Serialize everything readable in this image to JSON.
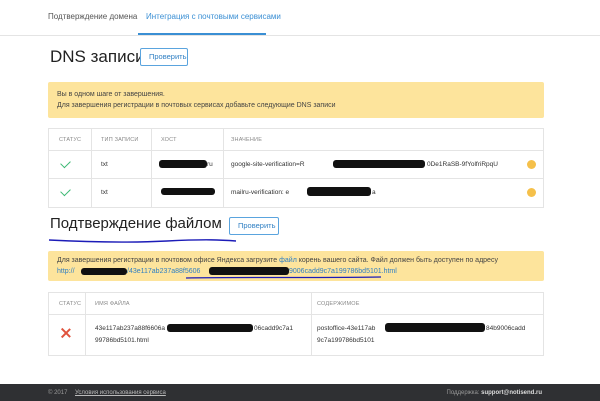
{
  "tabs": [
    {
      "label": "Подтверждение домена"
    },
    {
      "label": "Интеграция с почтовыми сервисами"
    }
  ],
  "dns": {
    "title": "DNS записи",
    "check_button": "Проверить",
    "alert_line1": "Вы в одном шаге от завершения.",
    "alert_line2": "Для завершения регистрации в почтовых сервисах добавьте следующие DNS записи",
    "headers": [
      "СТАТУС",
      "ТИП ЗАПИСИ",
      "ХОСТ",
      "ЗНАЧЕНИЕ"
    ],
    "rows": [
      {
        "status": "ok",
        "type": "txt",
        "host_suffix": "ru",
        "value_start": "google-site-verification=R",
        "value_end": "0De1RaSB-9fYolfriRpqU"
      },
      {
        "status": "ok",
        "type": "txt",
        "host_suffix": "",
        "value_start": "mailru-verification: e",
        "value_end": "a"
      }
    ]
  },
  "file": {
    "title": "Подтверждение файлом",
    "check_button": "Проверить",
    "alert_text_before": "Для завершения регистрации в почтовом офисе Яндекса загрузите",
    "alert_link": "файл",
    "alert_text_after": "корень вашего сайта. Файл должен быть доступен по адресу",
    "url_prefix": "http://",
    "url_mid": "/43e117ab237a88f5606",
    "url_end": "9006cadd9c7a199786bd5101.html",
    "headers": [
      "СТАТУС",
      "ИМЯ ФАЙЛА",
      "СОДЕРЖИМОЕ"
    ],
    "rows": [
      {
        "status": "error",
        "name_start": "43e117ab237a88f6606a",
        "name_end": "06cadd9c7a1",
        "name_line2": "99786bd5101.html",
        "content_start": "postoffice-43e117ab",
        "content_end": "84b9006cadd",
        "content_line2": "9c7a199786bd5101"
      }
    ]
  },
  "footer": {
    "copyright": "© 2017",
    "terms": "Условия использования сервиса",
    "support_label": "Поддержка:",
    "support_email": "support@notisend.ru"
  },
  "colors": {
    "accent": "#3a8fd4",
    "alert_bg": "#fde49c",
    "ok": "#3bb873",
    "error": "#e0533d",
    "footer_bg": "#2f3033"
  }
}
